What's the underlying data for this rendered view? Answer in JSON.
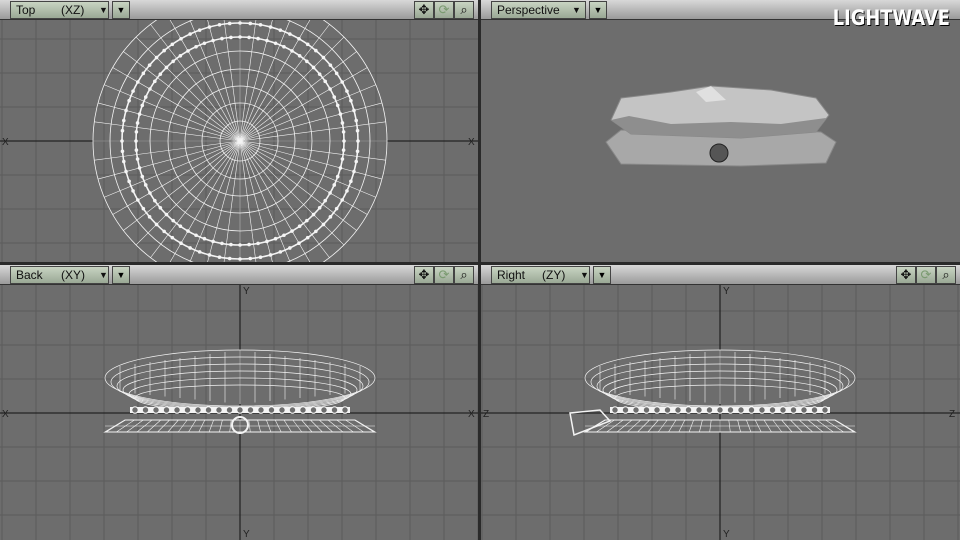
{
  "brand": "LIGHTWAVE",
  "viewports": [
    {
      "label": "Top",
      "axes": "(XZ)",
      "kind": "top"
    },
    {
      "label": "Perspective",
      "axes": "",
      "kind": "persp"
    },
    {
      "label": "Back",
      "axes": "(XY)",
      "kind": "back"
    },
    {
      "label": "Right",
      "axes": "(ZY)",
      "kind": "right"
    }
  ],
  "axis_labels": {
    "x": "X",
    "y": "Y",
    "z": "Z"
  },
  "icons": {
    "move": "✥",
    "rotate": "⟳",
    "zoom": "🔍",
    "dropdown": "▼"
  }
}
